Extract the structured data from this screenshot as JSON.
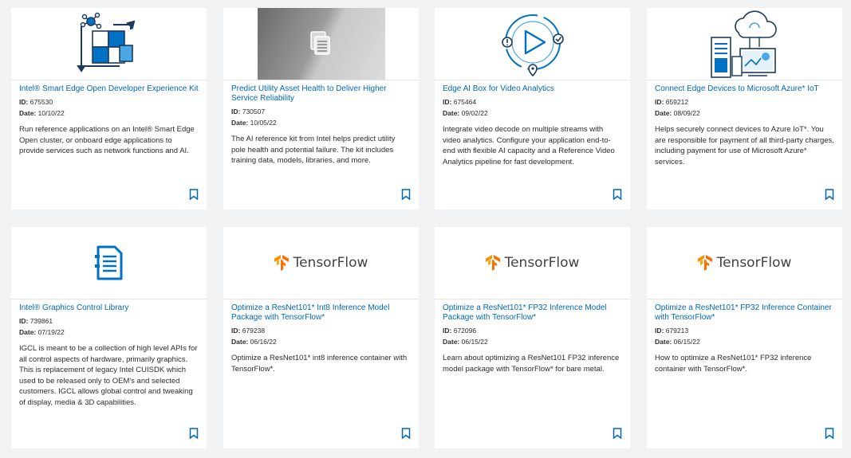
{
  "cards": [
    {
      "title": "Intel® Smart Edge Open Developer Experience Kit",
      "id_label": "ID:",
      "id": "675530",
      "date_label": "Date:",
      "date": "10/10/22",
      "description": "Run reference applications on an Intel® Smart Edge Open cluster, or onboard edge applications to provide services such as network functions and AI.",
      "icon": "puzzle-network-icon"
    },
    {
      "title": "Predict Utility Asset Health to Deliver Higher Service Reliability",
      "id_label": "ID:",
      "id": "730507",
      "date_label": "Date:",
      "date": "10/05/22",
      "description": "The AI reference kit from Intel helps predict utility pole health and potential failure. The kit includes training data, models, libraries, and more.",
      "icon": "documents-icon"
    },
    {
      "title": "Edge AI Box for Video Analytics",
      "id_label": "ID:",
      "id": "675464",
      "date_label": "Date:",
      "date": "09/02/22",
      "description": "Integrate video decode on multiple streams with video analytics. Configure your application end-to-end with flexible AI capacity and a Reference Video Analytics pipeline for fast development.",
      "icon": "video-play-icon"
    },
    {
      "title": "Connect Edge Devices to Microsoft Azure* IoT",
      "id_label": "ID:",
      "id": "659212",
      "date_label": "Date:",
      "date": "08/09/22",
      "description": "Helps securely connect devices to Azure IoT*. You are responsible for payment of all third-party charges, including payment for use of Microsoft Azure* services.",
      "icon": "cloud-devices-icon"
    },
    {
      "title": "Intel® Graphics Control Library",
      "id_label": "ID:",
      "id": "739861",
      "date_label": "Date:",
      "date": "07/19/22",
      "description": "IGCL is meant to be a collection of high level APIs for all control aspects of hardware, primarily graphics. This is replacement of legacy Intel CUISDK which used to be released only to OEM's and selected customers. IGCL allows global control and tweaking of display, media & 3D capabilities.",
      "icon": "document-list-icon"
    },
    {
      "title": "Optimize a ResNet101* Int8 Inference Model Package with TensorFlow*",
      "id_label": "ID:",
      "id": "679238",
      "date_label": "Date:",
      "date": "06/16/22",
      "description": "Optimize a ResNet101* int8 inference container with TensorFlow*.",
      "icon": "tensorflow-logo",
      "logo_text": "TensorFlow"
    },
    {
      "title": "Optimize a ResNet101* FP32 Inference Model Package with TensorFlow*",
      "id_label": "ID:",
      "id": "672096",
      "date_label": "Date:",
      "date": "06/15/22",
      "description": "Learn about optimizing a ResNet101 FP32 inference model package with TensorFlow* for bare metal.",
      "icon": "tensorflow-logo",
      "logo_text": "TensorFlow"
    },
    {
      "title": "Optimize a ResNet101* FP32 Inference Container with TensorFlow*",
      "id_label": "ID:",
      "id": "679213",
      "date_label": "Date:",
      "date": "06/15/22",
      "description": "How to optimize a ResNet101* FP32 inference container with TensorFlow*.",
      "icon": "tensorflow-logo",
      "logo_text": "TensorFlow"
    }
  ],
  "colors": {
    "accent": "#0068b5",
    "page_bg": "#f0f2f4",
    "card_bg": "#ffffff",
    "tensorflow_orange": "#ff6f00"
  }
}
